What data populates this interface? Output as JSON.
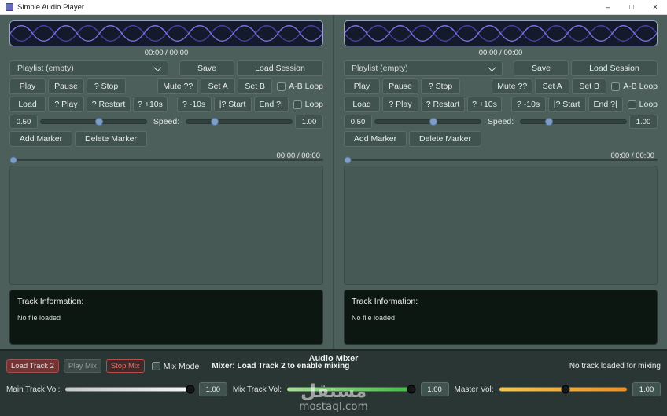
{
  "window": {
    "title": "Simple Audio Player",
    "minimize_glyph": "–",
    "maximize_glyph": "□",
    "close_glyph": "×"
  },
  "player": {
    "waveform_time": "00:00 / 00:00",
    "playlist_selected": "Playlist (empty)",
    "buttons": {
      "save": "Save",
      "load_session": "Load Session",
      "play": "Play",
      "pause": "Pause",
      "stop": "? Stop",
      "mute": "Mute ??",
      "set_a": "Set A",
      "set_b": "Set B",
      "load": "Load",
      "cue_play": "? Play",
      "restart": "? Restart",
      "forward_10s": "? +10s",
      "back_10s": "? -10s",
      "to_start": "|? Start",
      "to_end": "End ?|",
      "add_marker": "Add Marker",
      "delete_marker": "Delete Marker"
    },
    "checkboxes": {
      "ab_loop": "A-B Loop",
      "loop": "Loop"
    },
    "volume": {
      "value": "0.50"
    },
    "speed": {
      "label": "Speed:",
      "value": "1.00"
    },
    "progress_time": "00:00 / 00:00",
    "track_info": {
      "heading": "Track Information:",
      "message": "No file loaded"
    }
  },
  "mixer": {
    "title": "Audio Mixer",
    "load_track_2": "Load Track 2",
    "play_mix": "Play Mix",
    "stop_mix": "Stop Mix",
    "mix_mode": "Mix Mode",
    "status": "Mixer: Load Track 2 to enable mixing",
    "track_status": "No track loaded for mixing",
    "main_vol": {
      "label": "Main Track Vol:",
      "value": "1.00"
    },
    "mix_vol": {
      "label": "Mix Track Vol:",
      "value": "1.00"
    },
    "master_vol": {
      "label": "Master Vol:",
      "value": "1.00"
    }
  },
  "watermark": {
    "name": "مستقل",
    "domain": "mostaql.com"
  },
  "colors": {
    "background": "#4d5f5b",
    "mixer_background": "#2a3633",
    "button": "#41534f",
    "slider_handle": "#7e9ec6",
    "main_vol_track": "#e8ecea",
    "mix_vol_track": "#3cbb3c",
    "master_vol_track": "#ee9020",
    "load_track_button": "#743434",
    "stop_mix_accent": "#c05050",
    "waveform_wave": "#7b6fe0"
  }
}
